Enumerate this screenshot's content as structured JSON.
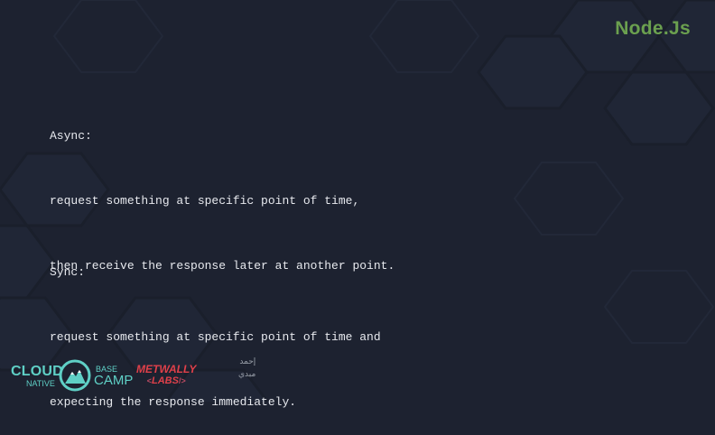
{
  "brand": {
    "label": "Node.Js",
    "color": "#6ba04f"
  },
  "async": {
    "heading": "Async:",
    "line1": "request something at specific point of time,",
    "line2": "then receive the response later at another point."
  },
  "sync": {
    "heading": "Sync:",
    "line1": "request something at specific point of time and",
    "line2": "expecting the response immediately."
  },
  "footer": {
    "cloud_native": {
      "cloud": "CLOUD",
      "native": "NATIVE",
      "base": "BASE",
      "camp": "CAMP",
      "color": "#5fd0c6"
    },
    "metwally": {
      "top": "METWALLY",
      "labs": "LABS",
      "open": "<",
      "close": "/>",
      "color": "#e0404a"
    },
    "arabic": {
      "line1": "إحمد",
      "line2": "مبدي"
    }
  },
  "colors": {
    "background": "#1d2230",
    "text": "#e7e9ee"
  }
}
